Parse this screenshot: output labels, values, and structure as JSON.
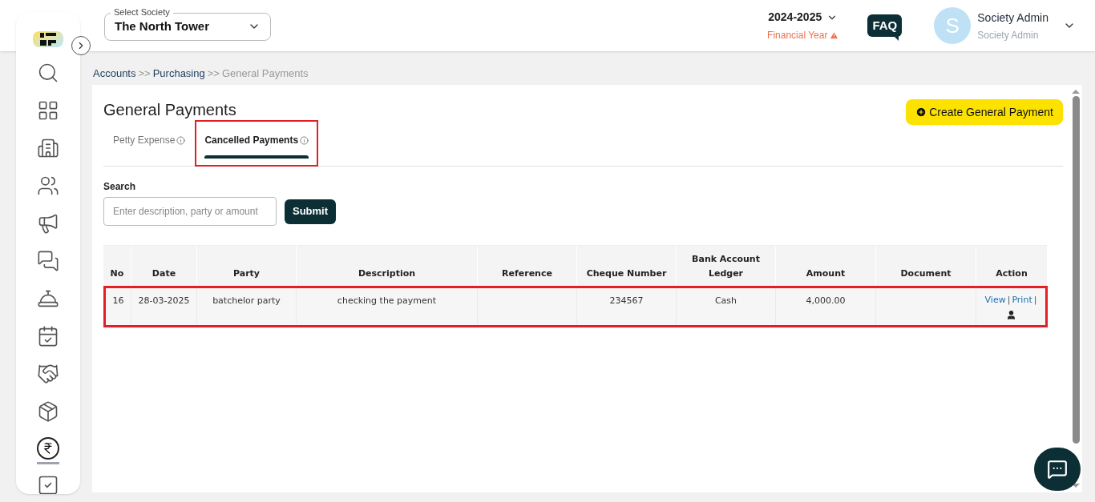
{
  "header": {
    "society": {
      "label": "Select Society",
      "value": "The North Tower"
    },
    "year": {
      "value": "2024-2025",
      "caption": "Financial Year",
      "warning": true
    },
    "faq": "FAQ",
    "user": {
      "initial": "S",
      "name": "Society Admin",
      "role": "Society Admin"
    }
  },
  "sidebar": {
    "items": [
      {
        "selected": false
      },
      {
        "selected": false
      },
      {
        "selected": false
      },
      {
        "selected": false
      },
      {
        "selected": false
      },
      {
        "selected": false
      },
      {
        "selected": false
      },
      {
        "selected": false
      },
      {
        "selected": false
      },
      {
        "selected": false
      },
      {
        "selected": true
      },
      {
        "selected": false
      }
    ]
  },
  "breadcrumb": [
    {
      "label": "Accounts",
      "current": false
    },
    {
      "label": "Purchasing",
      "current": false
    },
    {
      "label": "General Payments",
      "current": true
    }
  ],
  "breadcrumb_separator": ">>",
  "page": {
    "title": "General Payments",
    "create_button": "Create General Payment"
  },
  "tabs": [
    {
      "label": "Petty Expense",
      "selected": false,
      "highlighted": false
    },
    {
      "label": "Cancelled Payments",
      "selected": true,
      "highlighted": true
    }
  ],
  "search": {
    "label": "Search",
    "placeholder": "Enter description, party or amount",
    "button": "Submit"
  },
  "table": {
    "columns": [
      "No",
      "Date",
      "Party",
      "Description",
      "Reference",
      "Cheque Number",
      "Bank Account Ledger",
      "Amount",
      "Document",
      "Action"
    ],
    "rows": [
      {
        "highlighted": true,
        "cells": [
          "16",
          "28-03-2025",
          "batchelor party",
          "checking the payment",
          "",
          "234567",
          "Cash",
          "4,000.00",
          ""
        ],
        "actions": [
          "View",
          "Print"
        ],
        "separator": "|"
      }
    ]
  }
}
